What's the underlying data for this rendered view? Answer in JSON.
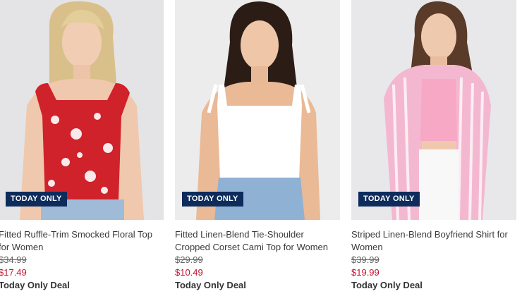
{
  "products": [
    {
      "badge": "TODAY ONLY",
      "title": "Fitted Ruffle-Trim Smocked Floral Top for Women",
      "was_price": "$34.99",
      "now_price": "$17.49",
      "deal": "Today Only Deal",
      "colors": {
        "garment": "#d0222b",
        "bg": "#e4e4e6",
        "hair": "#d9c08a"
      }
    },
    {
      "badge": "TODAY ONLY",
      "title": "Fitted Linen-Blend Tie-Shoulder Cropped Corset Cami Top for Women",
      "was_price": "$29.99",
      "now_price": "$10.49",
      "deal": "Today Only Deal",
      "colors": {
        "garment": "#ffffff",
        "bg": "#ececec",
        "hair": "#2b1d16"
      }
    },
    {
      "badge": "TODAY ONLY",
      "title": "Striped Linen-Blend Boyfriend Shirt for Women",
      "was_price": "$39.99",
      "now_price": "$19.99",
      "deal": "Today Only Deal",
      "colors": {
        "garment": "#f3b8cf",
        "bg": "#e8e8ea",
        "hair": "#5a3a28"
      }
    }
  ],
  "colors": {
    "badge_bg": "#0d2c5c",
    "sale_price": "#c8102e"
  }
}
